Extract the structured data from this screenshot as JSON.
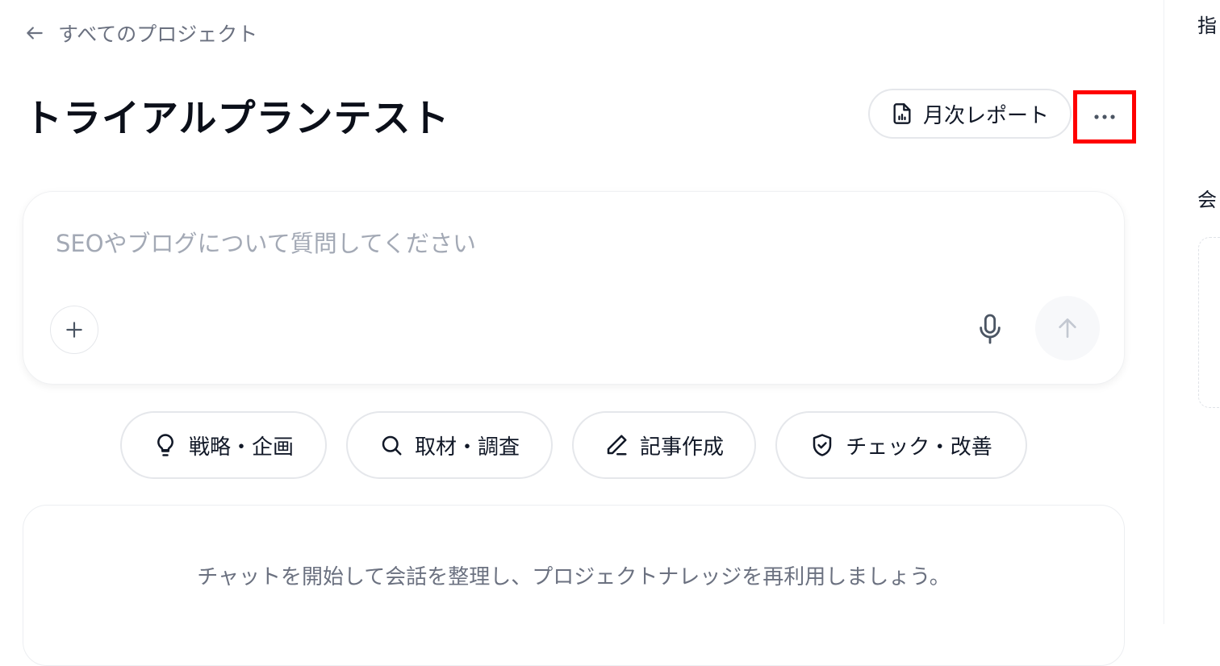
{
  "nav": {
    "back_label": "すべてのプロジェクト"
  },
  "header": {
    "title": "トライアルプランテスト",
    "report_label": "月次レポート"
  },
  "composer": {
    "placeholder": "SEOやブログについて質問してください",
    "value": ""
  },
  "chips": [
    {
      "label": "戦略・企画",
      "icon": "lightbulb-icon"
    },
    {
      "label": "取材・調査",
      "icon": "search-icon"
    },
    {
      "label": "記事作成",
      "icon": "pencil-icon"
    },
    {
      "label": "チェック・改善",
      "icon": "shield-check-icon"
    }
  ],
  "empty_state": {
    "message": "チャットを開始して会話を整理し、プロジェクトナレッジを再利用しましょう。"
  },
  "right_panel": {
    "heading_char": "指",
    "section_char": "会"
  },
  "colors": {
    "highlight": "#ff0000",
    "muted_text": "#6b7180",
    "placeholder": "#a3a9b5",
    "border": "#e5e7eb"
  }
}
